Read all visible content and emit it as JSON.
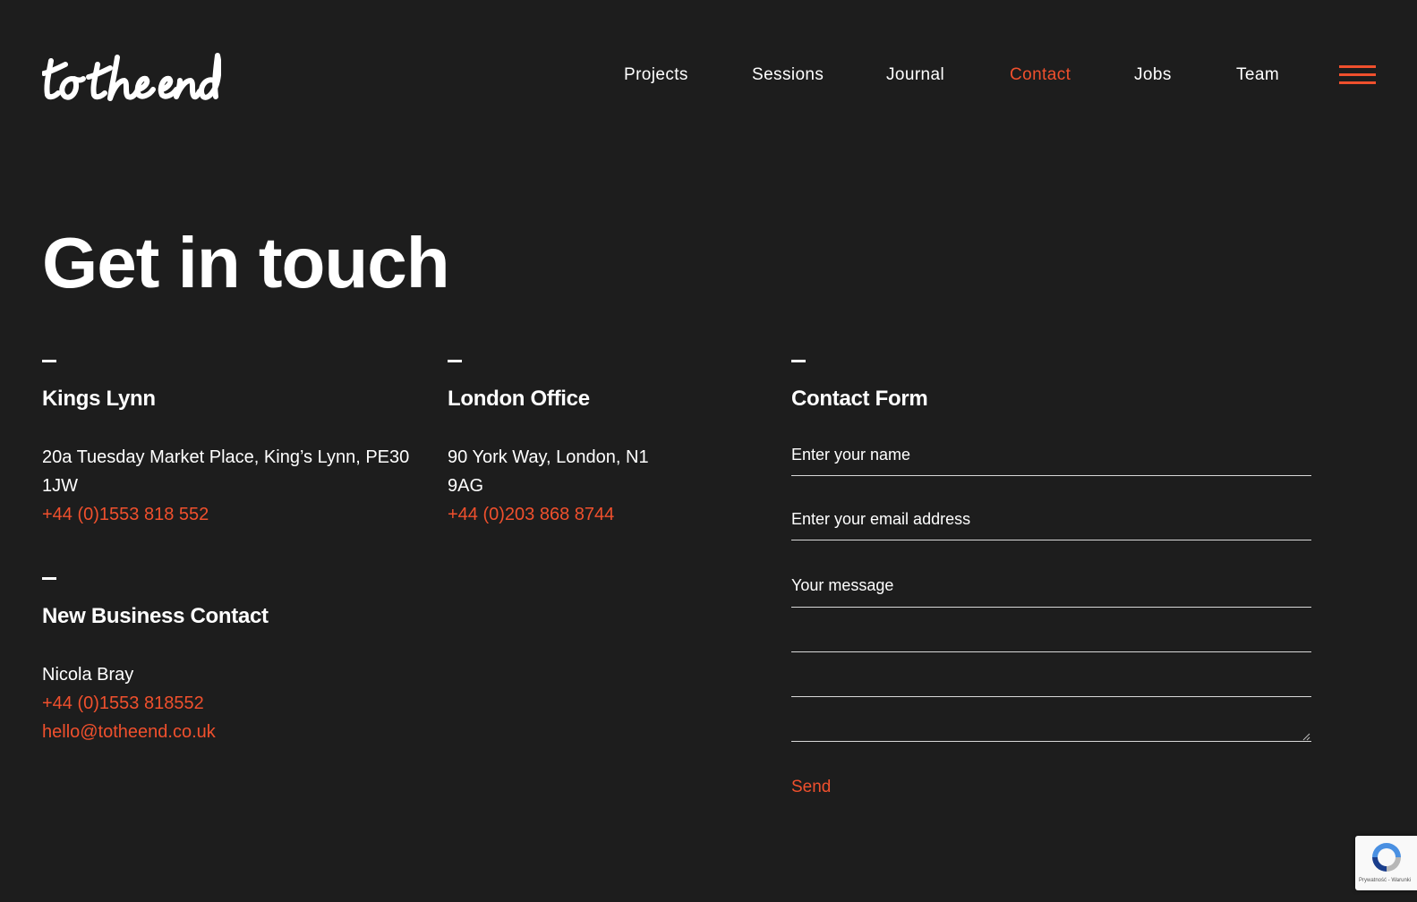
{
  "header": {
    "logo_text": "to the end",
    "nav": [
      {
        "label": "Projects",
        "active": false
      },
      {
        "label": "Sessions",
        "active": false
      },
      {
        "label": "Journal",
        "active": false
      },
      {
        "label": "Contact",
        "active": true
      },
      {
        "label": "Jobs",
        "active": false
      },
      {
        "label": "Team",
        "active": false
      }
    ],
    "menu_icon": "hamburger-icon"
  },
  "main": {
    "title": "Get in touch",
    "kings_lynn": {
      "heading": "Kings Lynn",
      "address_line1": "20a Tuesday Market Place, King’s Lynn, PE30",
      "address_line2": "1JW",
      "phone": "+44 (0)1553 818 552"
    },
    "london": {
      "heading": "London Office",
      "address_line1": "90 York Way, London, N1",
      "address_line2": "9AG",
      "phone": "+44 (0)203 868 8744"
    },
    "new_business": {
      "heading": "New Business Contact",
      "name": "Nicola Bray",
      "phone": "+44 (0)1553 818552",
      "email": "hello@totheend.co.uk"
    },
    "contact_form": {
      "heading": "Contact Form",
      "name_placeholder": "Enter your name",
      "email_placeholder": "Enter your email address",
      "message_placeholder": "Your message",
      "send_label": "Send"
    }
  },
  "recaptcha": {
    "text": "Prywatność - Warunki",
    "icon": "recaptcha-icon"
  },
  "colors": {
    "background": "#1d1d1d",
    "accent": "#f0502d",
    "text": "#ffffff"
  }
}
